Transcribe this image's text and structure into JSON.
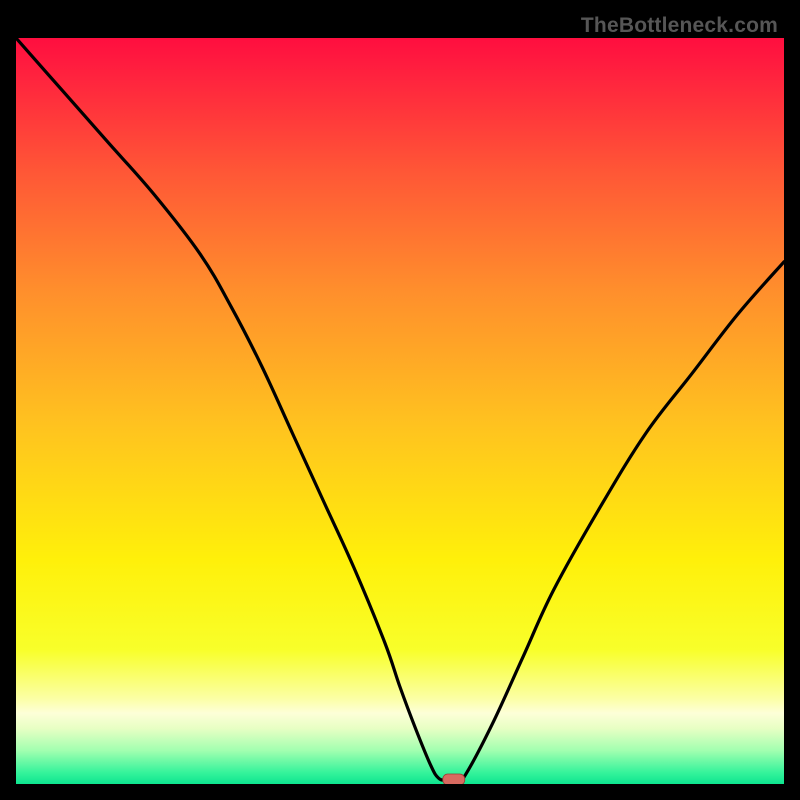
{
  "watermark": "TheBottleneck.com",
  "chart_data": {
    "type": "line",
    "title": "",
    "xlabel": "",
    "ylabel": "",
    "xlim": [
      0,
      100
    ],
    "ylim": [
      0,
      100
    ],
    "grid": false,
    "legend": false,
    "x": [
      0,
      6,
      12,
      18,
      24,
      28,
      32,
      36,
      40,
      44,
      48,
      50,
      52,
      54,
      55,
      56,
      57.5,
      58.5,
      62,
      66,
      70,
      76,
      82,
      88,
      94,
      100
    ],
    "y": [
      100,
      93,
      86,
      79,
      71,
      64,
      56,
      47,
      38,
      29,
      19,
      13,
      7.5,
      2.5,
      0.8,
      0.5,
      0.5,
      1.2,
      8,
      17,
      26,
      37,
      47,
      55,
      63,
      70
    ],
    "marker": {
      "x": 57,
      "y": 0.6
    },
    "background": {
      "stops": [
        {
          "offset": 0.0,
          "color": "#ff0e3f"
        },
        {
          "offset": 0.035,
          "color": "#ff1c3f"
        },
        {
          "offset": 0.18,
          "color": "#ff5736"
        },
        {
          "offset": 0.34,
          "color": "#ff8f2c"
        },
        {
          "offset": 0.52,
          "color": "#ffc31f"
        },
        {
          "offset": 0.7,
          "color": "#fff00a"
        },
        {
          "offset": 0.82,
          "color": "#f8ff2a"
        },
        {
          "offset": 0.885,
          "color": "#fbffa4"
        },
        {
          "offset": 0.905,
          "color": "#fdffd8"
        },
        {
          "offset": 0.925,
          "color": "#e8ffc4"
        },
        {
          "offset": 0.955,
          "color": "#a2ffb0"
        },
        {
          "offset": 0.985,
          "color": "#34f39b"
        },
        {
          "offset": 1.0,
          "color": "#0de58f"
        }
      ]
    }
  }
}
